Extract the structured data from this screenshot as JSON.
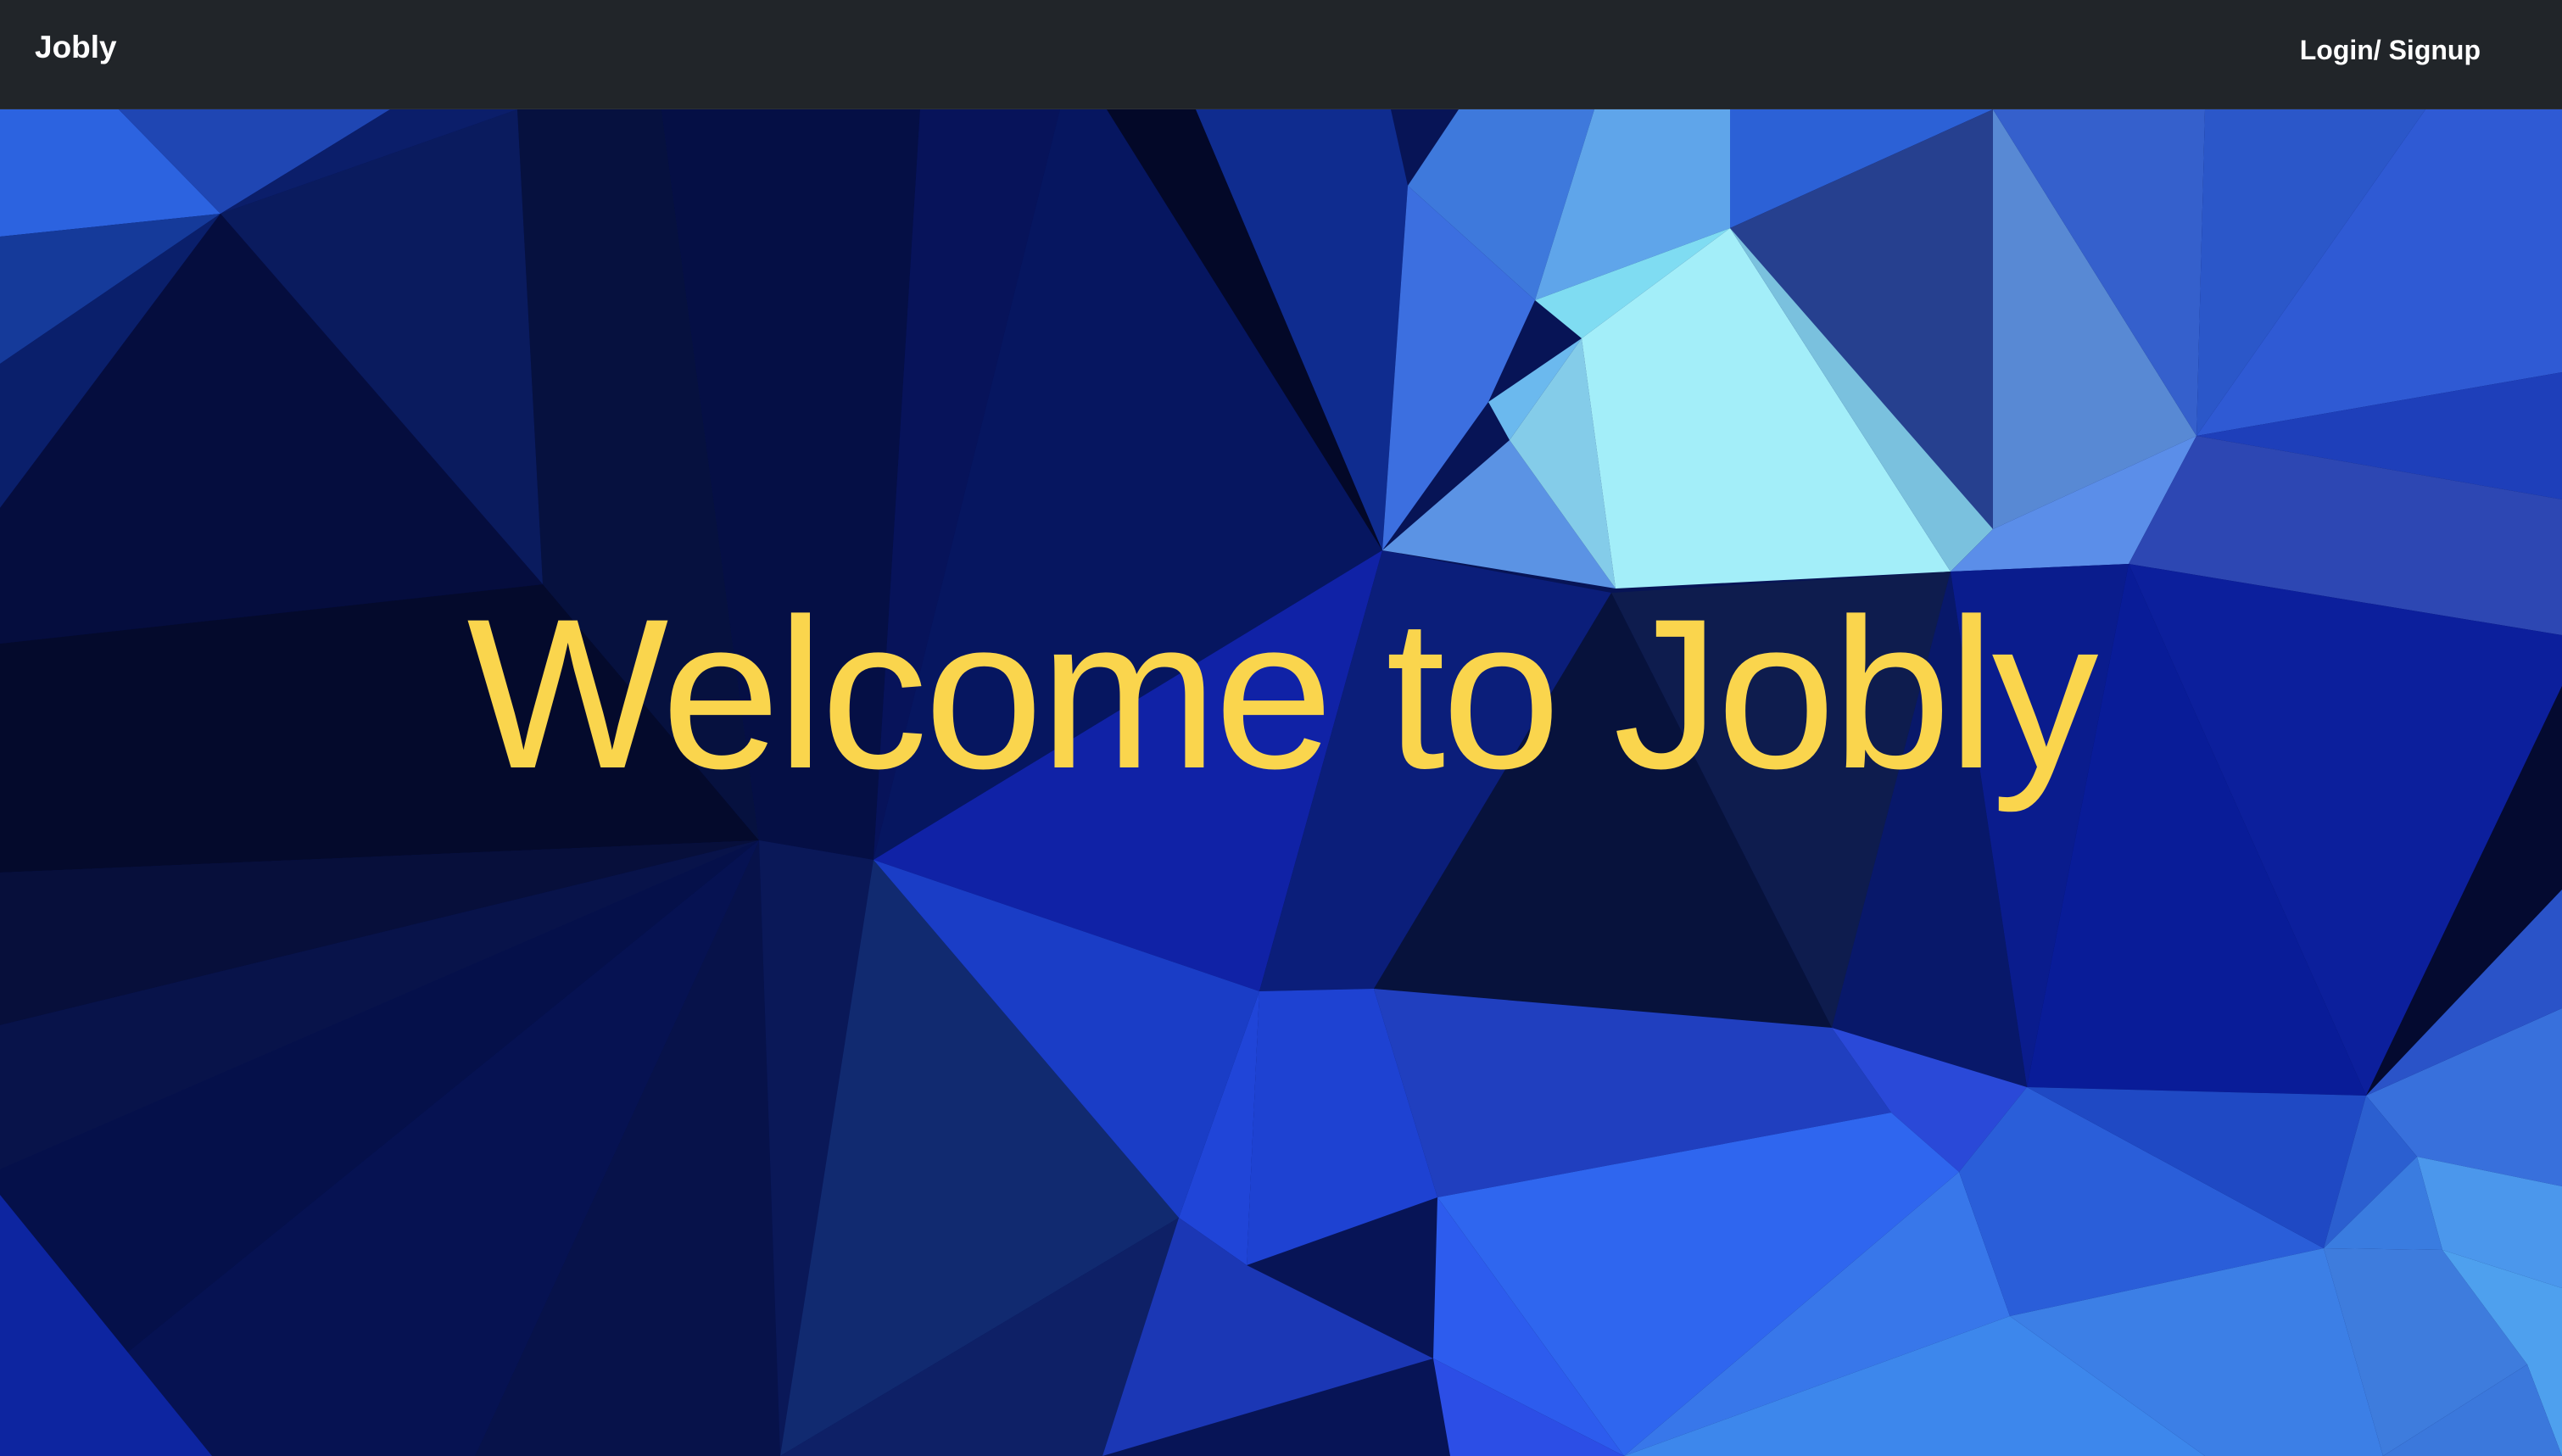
{
  "navbar": {
    "brand": "Jobly",
    "login_signup": "Login/ Signup"
  },
  "hero": {
    "title": "Welcome to Jobly",
    "title_color": "#fad54d",
    "background": "low-poly blue triangles"
  },
  "colors": {
    "navbar_bg": "#212529",
    "nav_text": "#ffffff"
  }
}
